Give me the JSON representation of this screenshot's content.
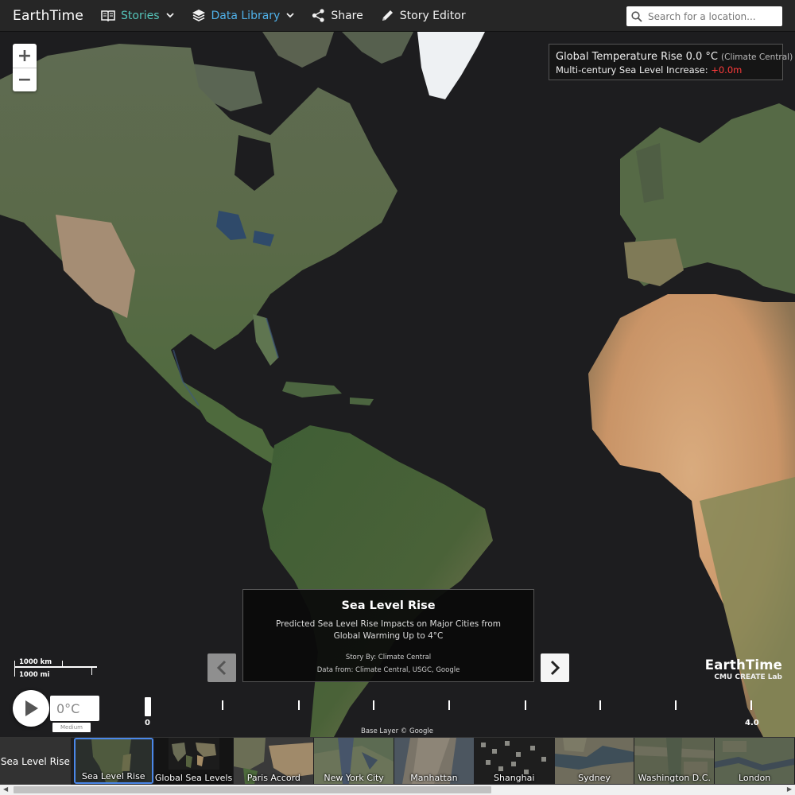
{
  "app": {
    "title": "EarthTime"
  },
  "nav": {
    "stories": "Stories",
    "data_library": "Data Library",
    "share": "Share",
    "story_editor": "Story Editor"
  },
  "search": {
    "placeholder": "Search for a location..."
  },
  "zoom": {
    "in": "+",
    "out": "−"
  },
  "legend": {
    "line1": "Global Temperature Rise 0.0 °C",
    "source": "(Climate Central)",
    "line2": "Multi-century Sea Level Increase:",
    "increase": "+0.0m",
    "increase_color": "#ff3b3b"
  },
  "scale": {
    "km": "1000 km",
    "mi": "1000 mi"
  },
  "story": {
    "title": "Sea Level Rise",
    "description": "Predicted Sea Level Rise Impacts on Major Cities from Global Warming Up to 4°C",
    "by": "Story By: Climate Central",
    "data_from": "Data from: Climate Central, USGC, Google"
  },
  "watermark": {
    "name": "EarthTime",
    "lab": "CMU CREATE Lab"
  },
  "timeline": {
    "temperature": "0°C",
    "quality": "Medium",
    "start_label": "0",
    "end_label": "4.0",
    "progress": 0
  },
  "attribution": "Base Layer © Google",
  "strip": {
    "category": "Sea Level Rise",
    "thumbnails": [
      {
        "label": "Sea Level Rise",
        "selected": true
      },
      {
        "label": "Global Sea Levels"
      },
      {
        "label": "Paris Accord"
      },
      {
        "label": "New York City"
      },
      {
        "label": "Manhattan"
      },
      {
        "label": "Shanghai"
      },
      {
        "label": "Sydney"
      },
      {
        "label": "Washington D.C."
      },
      {
        "label": "London"
      }
    ]
  },
  "colors": {
    "accent_stories": "#54c3b8",
    "accent_library": "#4fb0e8",
    "selected_border": "#4a87e8"
  }
}
